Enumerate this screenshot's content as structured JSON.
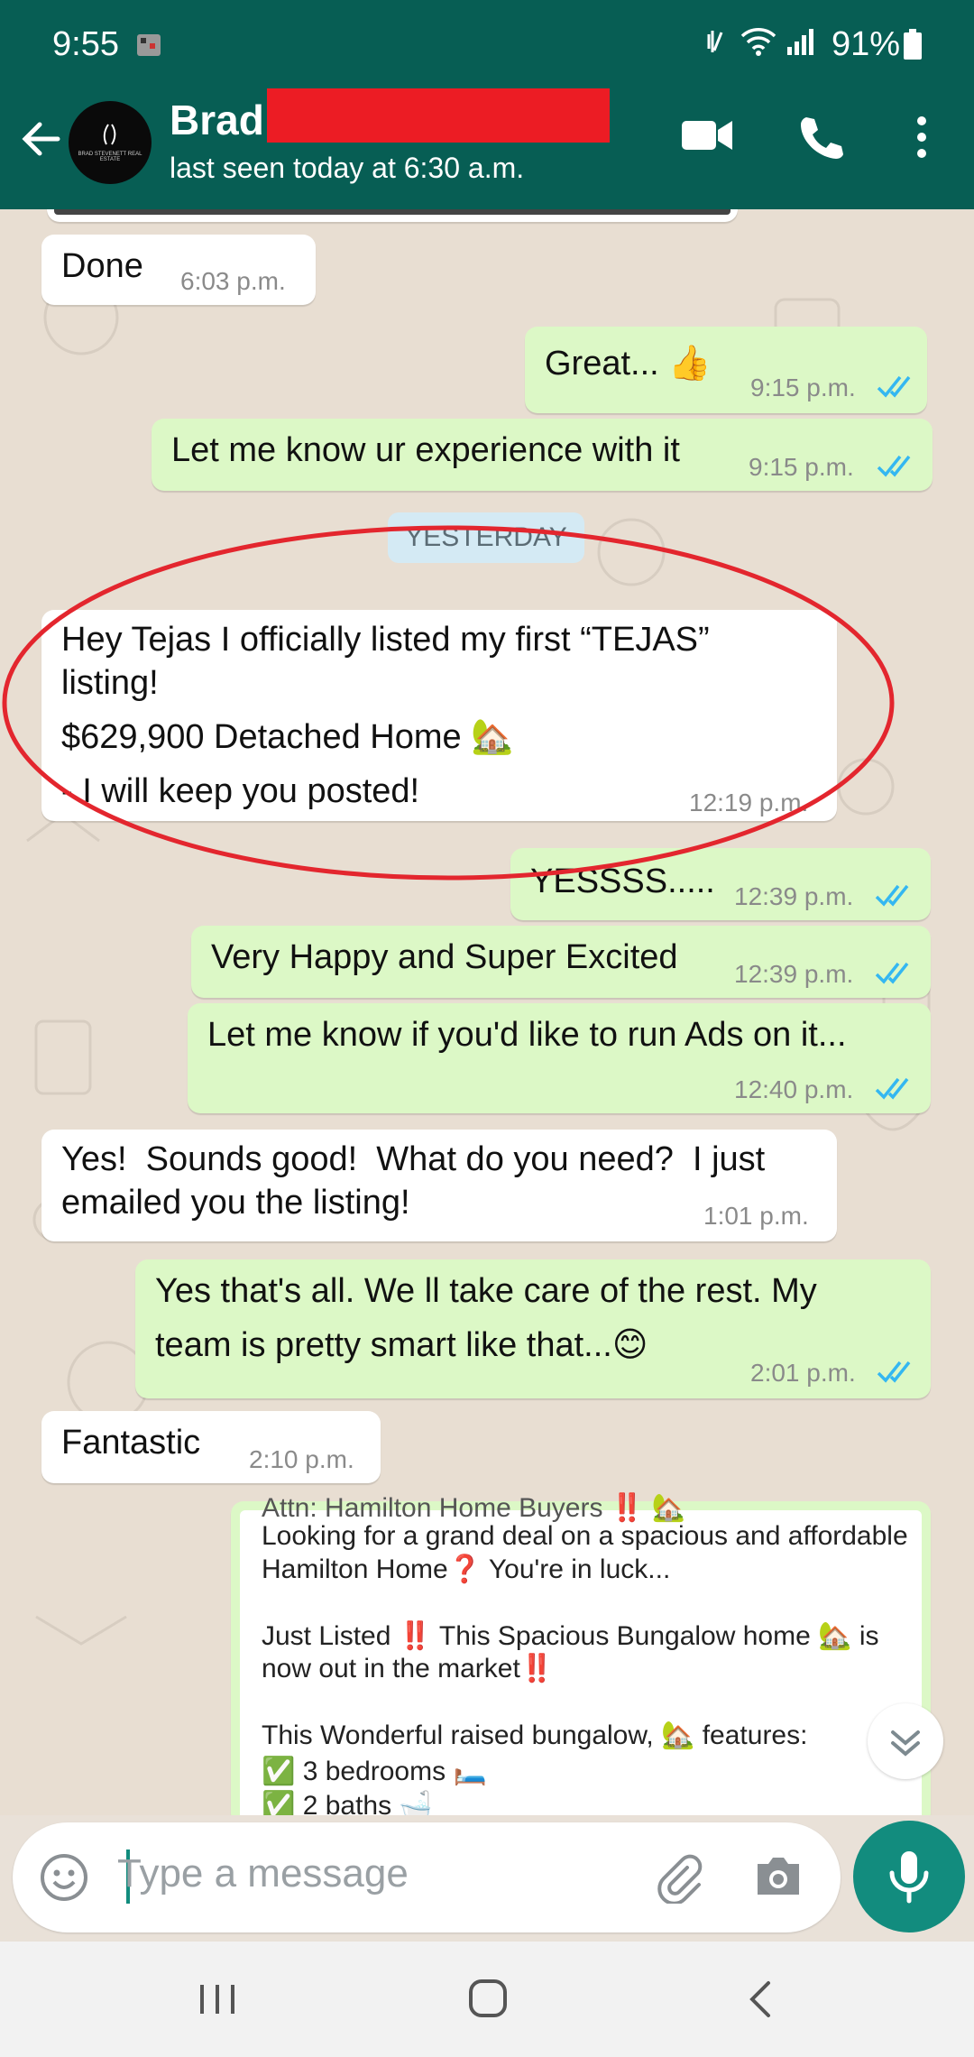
{
  "status_bar": {
    "time": "9:55",
    "battery": "91%"
  },
  "header": {
    "contact_name": "Brad",
    "avatar_text": "BRAD STEVENETT REAL ESTATE",
    "last_seen": "last seen today at 6:30 a.m."
  },
  "colors": {
    "header": "#075e54",
    "outgoing_bubble": "#dcf8c6",
    "incoming_bubble": "#ffffff",
    "accent": "#128c7e",
    "read_ticks": "#34b7f1",
    "annotation": "#e3262e"
  },
  "messages": {
    "m1": {
      "text": "Done",
      "time": "6:03 p.m."
    },
    "m2": {
      "text": "Great... 👍",
      "time": "9:15 p.m."
    },
    "m3": {
      "text": "Let me know ur experience with it",
      "time": "9:15 p.m."
    },
    "day_separator": "YESTERDAY",
    "m4": {
      "line1": "Hey Tejas I officially listed my first “TEJAS”",
      "line2": "listing!",
      "line3": "$629,900 Detached Home 🏡",
      "line4": "- I will keep you posted!",
      "time": "12:19 p.m."
    },
    "m5": {
      "text": "YESSSS.....",
      "time": "12:39 p.m."
    },
    "m6": {
      "text": "Very Happy and Super Excited",
      "time": "12:39 p.m."
    },
    "m7": {
      "text": "Let me know if you'd like to run Ads on it...",
      "time": "12:40 p.m."
    },
    "m8": {
      "line1": "Yes!  Sounds good!  What do you need?  I just",
      "line2": "emailed you the listing!",
      "time": "1:01 p.m."
    },
    "m9": {
      "line1": "Yes that's all. We ll take care of the rest. My",
      "line2": "team is pretty smart like that...😊",
      "time": "2:01 p.m."
    },
    "m10": {
      "text": "Fantastic",
      "time": "2:10 p.m."
    },
    "m11": {
      "lines": [
        "Attn: Hamilton Home Buyers ‼️ 🏡",
        "Looking for a grand deal on a spacious and affordable",
        "Hamilton Home❓ You're in luck...",
        "Just Listed ‼️ This Spacious Bungalow home 🏡 is",
        "now out in the market‼️",
        "This Wonderful raised bungalow, 🏡 features:",
        "✅ 3 bedrooms 🛏️",
        "✅ 2 baths 🛁"
      ]
    }
  },
  "input": {
    "placeholder": "Type a message"
  },
  "icons": {
    "back": "arrow-left-icon",
    "video": "video-camera-icon",
    "call": "phone-icon",
    "menu": "more-vertical-icon",
    "emoji": "emoji-icon",
    "attach": "paperclip-icon",
    "camera": "camera-icon",
    "mic": "microphone-icon",
    "scroll_down": "double-chevron-down-icon"
  }
}
